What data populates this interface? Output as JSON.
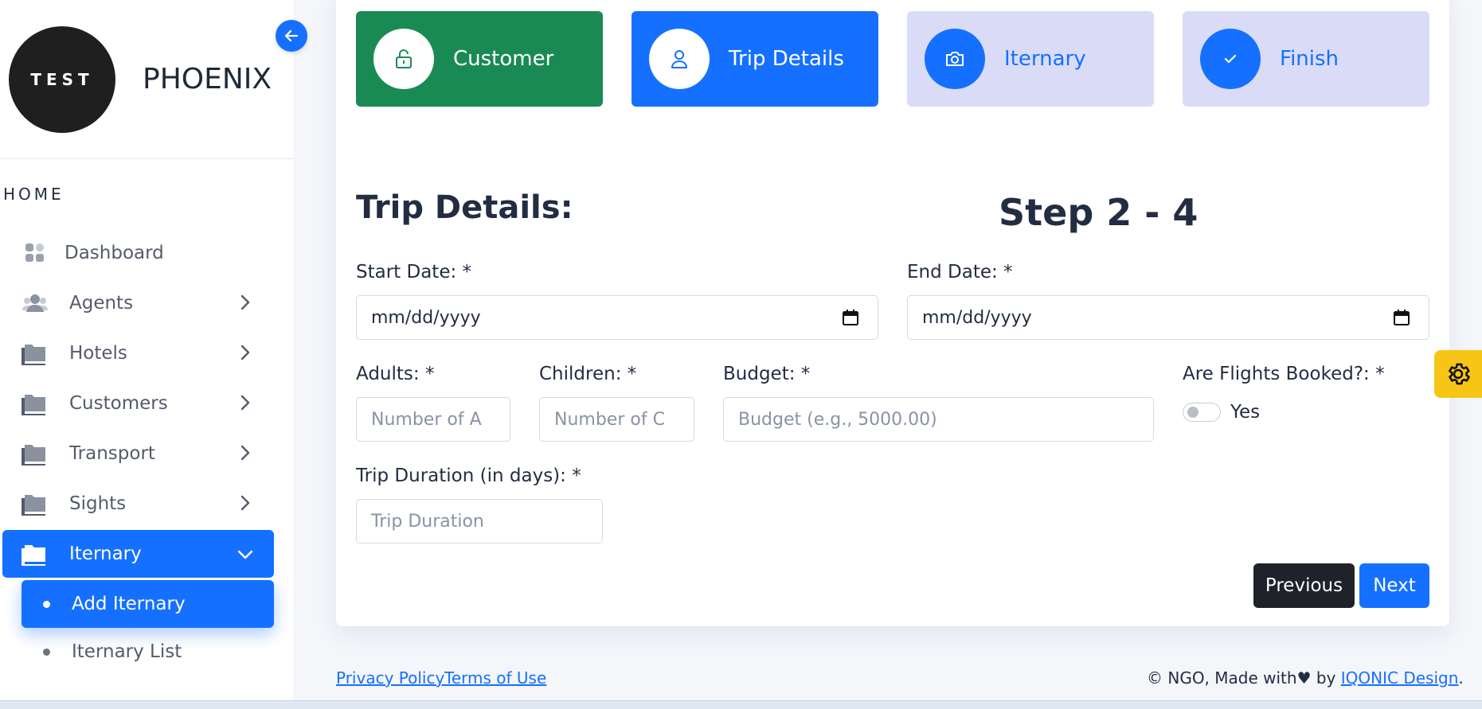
{
  "brand": {
    "logo_text": "TEST",
    "name": "PHOENIX"
  },
  "sidebar": {
    "section_label": "HOME",
    "items": [
      {
        "label": "Dashboard",
        "icon": "dashboard-icon"
      },
      {
        "label": "Agents",
        "icon": "users-icon"
      },
      {
        "label": "Hotels",
        "icon": "folder-icon"
      },
      {
        "label": "Customers",
        "icon": "folder-icon"
      },
      {
        "label": "Transport",
        "icon": "folder-icon"
      },
      {
        "label": "Sights",
        "icon": "folder-icon"
      },
      {
        "label": "Iternary",
        "icon": "folder-icon",
        "active": true
      }
    ],
    "sub_items": [
      {
        "label": "Add Iternary",
        "active": true
      },
      {
        "label": "Iternary List"
      }
    ]
  },
  "steps": [
    {
      "label": "Customer",
      "icon": "lock-icon",
      "state": "done"
    },
    {
      "label": "Trip Details",
      "icon": "user-icon",
      "state": "current"
    },
    {
      "label": "Iternary",
      "icon": "camera-icon",
      "state": "todo"
    },
    {
      "label": "Finish",
      "icon": "check-icon",
      "state": "todo"
    }
  ],
  "form": {
    "title": "Trip Details:",
    "step_count": "Step 2 - 4",
    "start_date": {
      "label": "Start Date: *",
      "value": "mm/dd/yyyy"
    },
    "end_date": {
      "label": "End Date: *",
      "value": "mm/dd/yyyy"
    },
    "adults": {
      "label": "Adults: *",
      "placeholder": "Number of A"
    },
    "children": {
      "label": "Children: *",
      "placeholder": "Number of C"
    },
    "budget": {
      "label": "Budget: *",
      "placeholder": "Budget (e.g., 5000.00)"
    },
    "flights": {
      "label": "Are Flights Booked?: *",
      "toggle_label": "Yes",
      "checked": false
    },
    "duration": {
      "label": "Trip Duration (in days): *",
      "placeholder": "Trip Duration"
    }
  },
  "buttons": {
    "previous": "Previous",
    "next": "Next"
  },
  "footer": {
    "privacy": "Privacy Policy",
    "terms": "Terms of Use",
    "copyright_prefix": "© NGO, Made with",
    "heart": "♥",
    "by": " by ",
    "author": "IQONIC Design",
    "suffix": "."
  },
  "colors": {
    "primary": "#1570ff",
    "success": "#1a8a55",
    "pending": "#dadcf7",
    "dark": "#1f2229",
    "warning": "#f7c515"
  }
}
